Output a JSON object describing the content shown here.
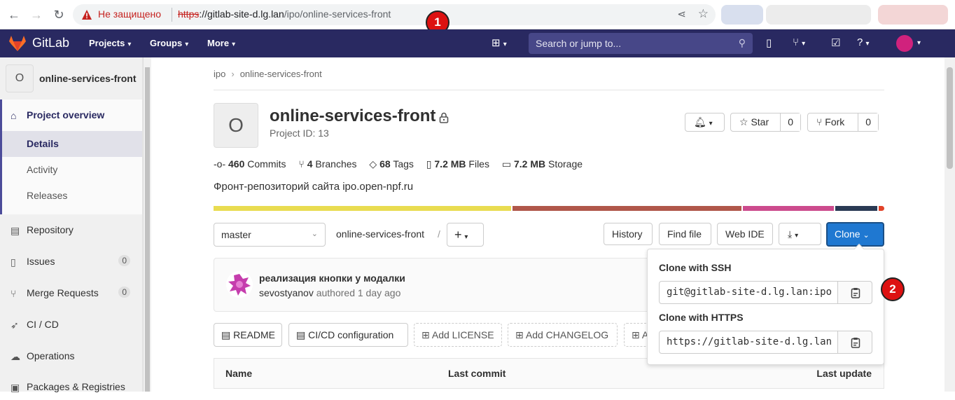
{
  "browser": {
    "insecure_label": "Не защищено",
    "url_scheme": "https",
    "url_host": "://gitlab-site-d.lg.lan",
    "url_path": "/ipo/online-services-front"
  },
  "markers": {
    "m1": "1",
    "m2": "2"
  },
  "header": {
    "brand": "GitLab",
    "nav": {
      "projects": "Projects",
      "groups": "Groups",
      "more": "More"
    },
    "search_placeholder": "Search or jump to..."
  },
  "sidebar": {
    "project_initial": "O",
    "project_name": "online-services-front",
    "overview": "Project overview",
    "sub": {
      "details": "Details",
      "activity": "Activity",
      "releases": "Releases"
    },
    "items": {
      "repository": "Repository",
      "issues": "Issues",
      "issues_count": "0",
      "merge_requests": "Merge Requests",
      "mr_count": "0",
      "cicd": "CI / CD",
      "operations": "Operations",
      "packages": "Packages & Registries"
    }
  },
  "breadcrumb": {
    "group": "ipo",
    "project": "online-services-front"
  },
  "project": {
    "initial": "O",
    "title": "online-services-front",
    "id_label": "Project ID: 13",
    "star_label": "Star",
    "star_count": "0",
    "fork_label": "Fork",
    "fork_count": "0",
    "description": "Фронт-репозиторий сайта ipo.open-npf.ru"
  },
  "stats": {
    "commits_num": "460",
    "commits_lbl": "Commits",
    "branches_num": "4",
    "branches_lbl": "Branches",
    "tags_num": "68",
    "tags_lbl": "Tags",
    "files_num": "7.2 MB",
    "files_lbl": "Files",
    "storage_num": "7.2 MB",
    "storage_lbl": "Storage"
  },
  "language_colors": [
    "#e9dc51",
    "#b0574a",
    "#cc4b8d",
    "#2a3a54",
    "#e24329"
  ],
  "repo_bar": {
    "branch": "master",
    "path": "online-services-front",
    "path_sep": "/",
    "history": "History",
    "find_file": "Find file",
    "web_ide": "Web IDE",
    "clone": "Clone"
  },
  "commit": {
    "message": "реализация кнопки у модалки",
    "author": "sevostyanov",
    "meta": "authored 1 day ago"
  },
  "actions": {
    "readme": "README",
    "cicd_config": "CI/CD configuration",
    "add_license": "Add LICENSE",
    "add_changelog": "Add CHANGELOG",
    "add_other": "A"
  },
  "table": {
    "name": "Name",
    "last_commit": "Last commit",
    "last_update": "Last update"
  },
  "clone_dropdown": {
    "ssh_label": "Clone with SSH",
    "ssh_url": "git@gitlab-site-d.lg.lan:ipo",
    "https_label": "Clone with HTTPS",
    "https_url": "https://gitlab-site-d.lg.lan"
  }
}
